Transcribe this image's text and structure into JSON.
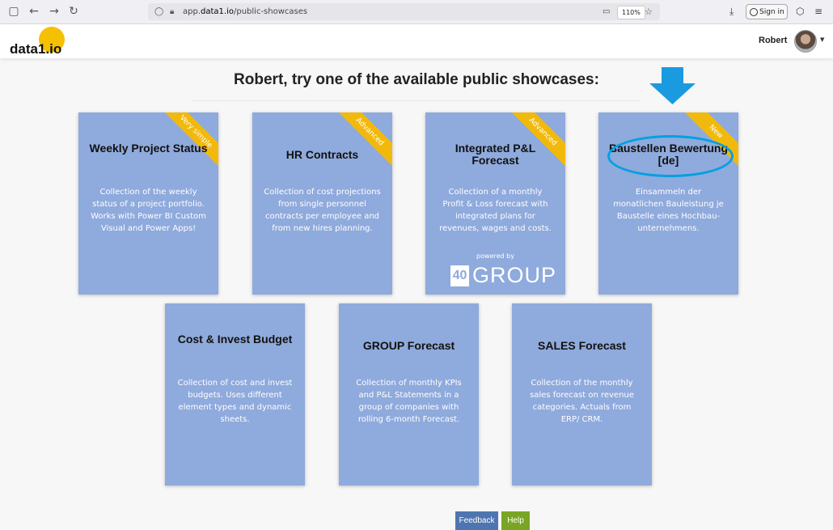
{
  "browser": {
    "url_prefix": "app.",
    "url_domain": "data1.io",
    "url_path": "/public-showcases",
    "zoom": "110%",
    "sign_in": "Sign in"
  },
  "header": {
    "logo": "data1.io",
    "user_name": "Robert"
  },
  "main": {
    "headline": "Robert, try one of the available public showcases:",
    "cards": [
      {
        "title": "Weekly Project Status",
        "ribbon": "Very simple",
        "description": "Collection of the weekly status of a project portfolio. Works with Power BI Custom Visual and Power Apps!"
      },
      {
        "title": "HR Contracts",
        "ribbon": "Advanced",
        "description": "Collection of cost projections from single personnel contracts per employee and from new hires planning."
      },
      {
        "title": "Integrated P&L Forecast",
        "ribbon": "Advanced",
        "description": "Collection of a monthly Profit & Loss forecast with integrated plans for revenues, wages and costs.",
        "powered_by": "powered by",
        "logo_box": "40",
        "logo_text": "GROUP"
      },
      {
        "title": "Baustellen Bewertung [de]",
        "ribbon": "New",
        "description": "Einsammeln der monatlichen Bauleistung je Baustelle eines Hochbau-unternehmens."
      },
      {
        "title": "Cost & Invest Budget",
        "description": "Collection of cost and invest budgets. Uses different element types and dynamic sheets."
      },
      {
        "title": "GROUP Forecast",
        "description": "Collection of monthly KPIs and P&L Statements in a group of companies with rolling 6-month Forecast."
      },
      {
        "title": "SALES Forecast",
        "description": "Collection of the monthly sales forecast on revenue categories. Actuals from ERP/ CRM."
      }
    ]
  },
  "footer": {
    "feedback": "Feedback",
    "help": "Help"
  },
  "colors": {
    "card": "#8faadc",
    "ribbon": "#f2b90d",
    "arrow": "#1a9be0",
    "highlight": "#00a0e3",
    "feedback": "#4e75b0",
    "help": "#7aa524"
  }
}
